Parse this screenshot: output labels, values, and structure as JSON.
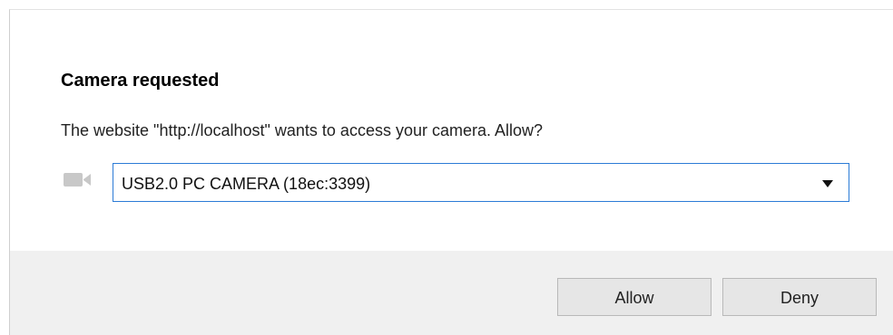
{
  "dialog": {
    "title": "Camera requested",
    "message": "The website \"http://localhost\" wants to access your camera. Allow?",
    "device_icon": "video-camera-icon",
    "device_select": {
      "selected": "USB2.0 PC CAMERA (18ec:3399)",
      "arrow_icon": "dropdown-arrow-icon"
    },
    "buttons": {
      "allow_label": "Allow",
      "deny_label": "Deny"
    }
  },
  "colors": {
    "select_border": "#2b7bd6",
    "footer_background": "#f0f0f0",
    "button_background": "#e6e6e6"
  }
}
